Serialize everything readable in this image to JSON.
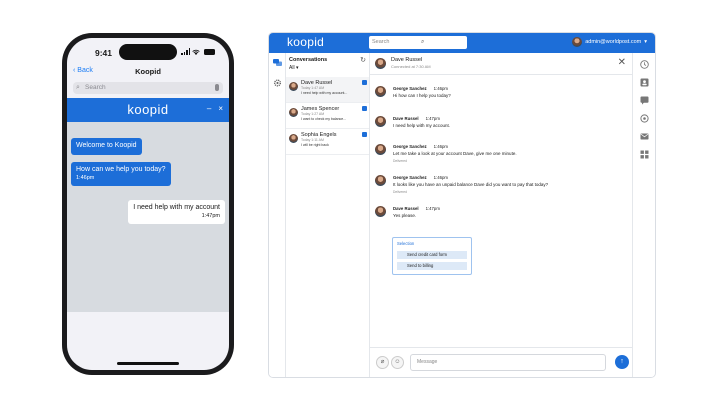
{
  "phone": {
    "time": "9:41",
    "nav": {
      "back_label": "Back",
      "title": "Koopid"
    },
    "search_placeholder": "Search",
    "chat": {
      "logo": "koopid",
      "minimize": "–",
      "close": "×",
      "messages": [
        {
          "side": "in",
          "text": "Welcome to Koopid",
          "time": ""
        },
        {
          "side": "in",
          "text": "How can we help you today?",
          "time": "1:46pm"
        },
        {
          "side": "out",
          "text": "I need help with my account",
          "time": "1:47pm"
        }
      ]
    }
  },
  "app": {
    "logo": "koopid",
    "search_placeholder": "Search",
    "user_email": "admin@worldpost.com",
    "conversations": {
      "title": "Conversations",
      "filter": "All",
      "items": [
        {
          "name": "Dave Russel",
          "time": "Today 1:47 AM",
          "preview": "I need help with my account..."
        },
        {
          "name": "James Spencer",
          "time": "Today 1:27 AM",
          "preview": "I want to check my balance..."
        },
        {
          "name": "Sophia Engels",
          "time": "Today 1:11 AM",
          "preview": "I will be right back"
        }
      ]
    },
    "header": {
      "name": "Dave Russel",
      "subtitle": "Connected at 7:30 AM"
    },
    "messages": [
      {
        "author": "George Sanchez",
        "time": "1:46pm",
        "text": "Hi how can I help you today?",
        "status": ""
      },
      {
        "author": "Dave Russel",
        "time": "1:47pm",
        "text": "I need help with my account.",
        "status": ""
      },
      {
        "author": "George Sanchez",
        "time": "1:46pm",
        "text": "Let me take a look at your account Dave, give me one minute.",
        "status": "Delivered"
      },
      {
        "author": "George Sanchez",
        "time": "1:46pm",
        "text": "It looks like you have an unpaid balance Dave did you want to pay that today?",
        "status": "Delivered"
      },
      {
        "author": "Dave Russel",
        "time": "1:47pm",
        "text": "Yes please.",
        "status": ""
      }
    ],
    "card": {
      "title": "Selection",
      "options": [
        "Send credit card form",
        "Send to billing"
      ]
    },
    "composer": {
      "placeholder": "Message"
    }
  }
}
